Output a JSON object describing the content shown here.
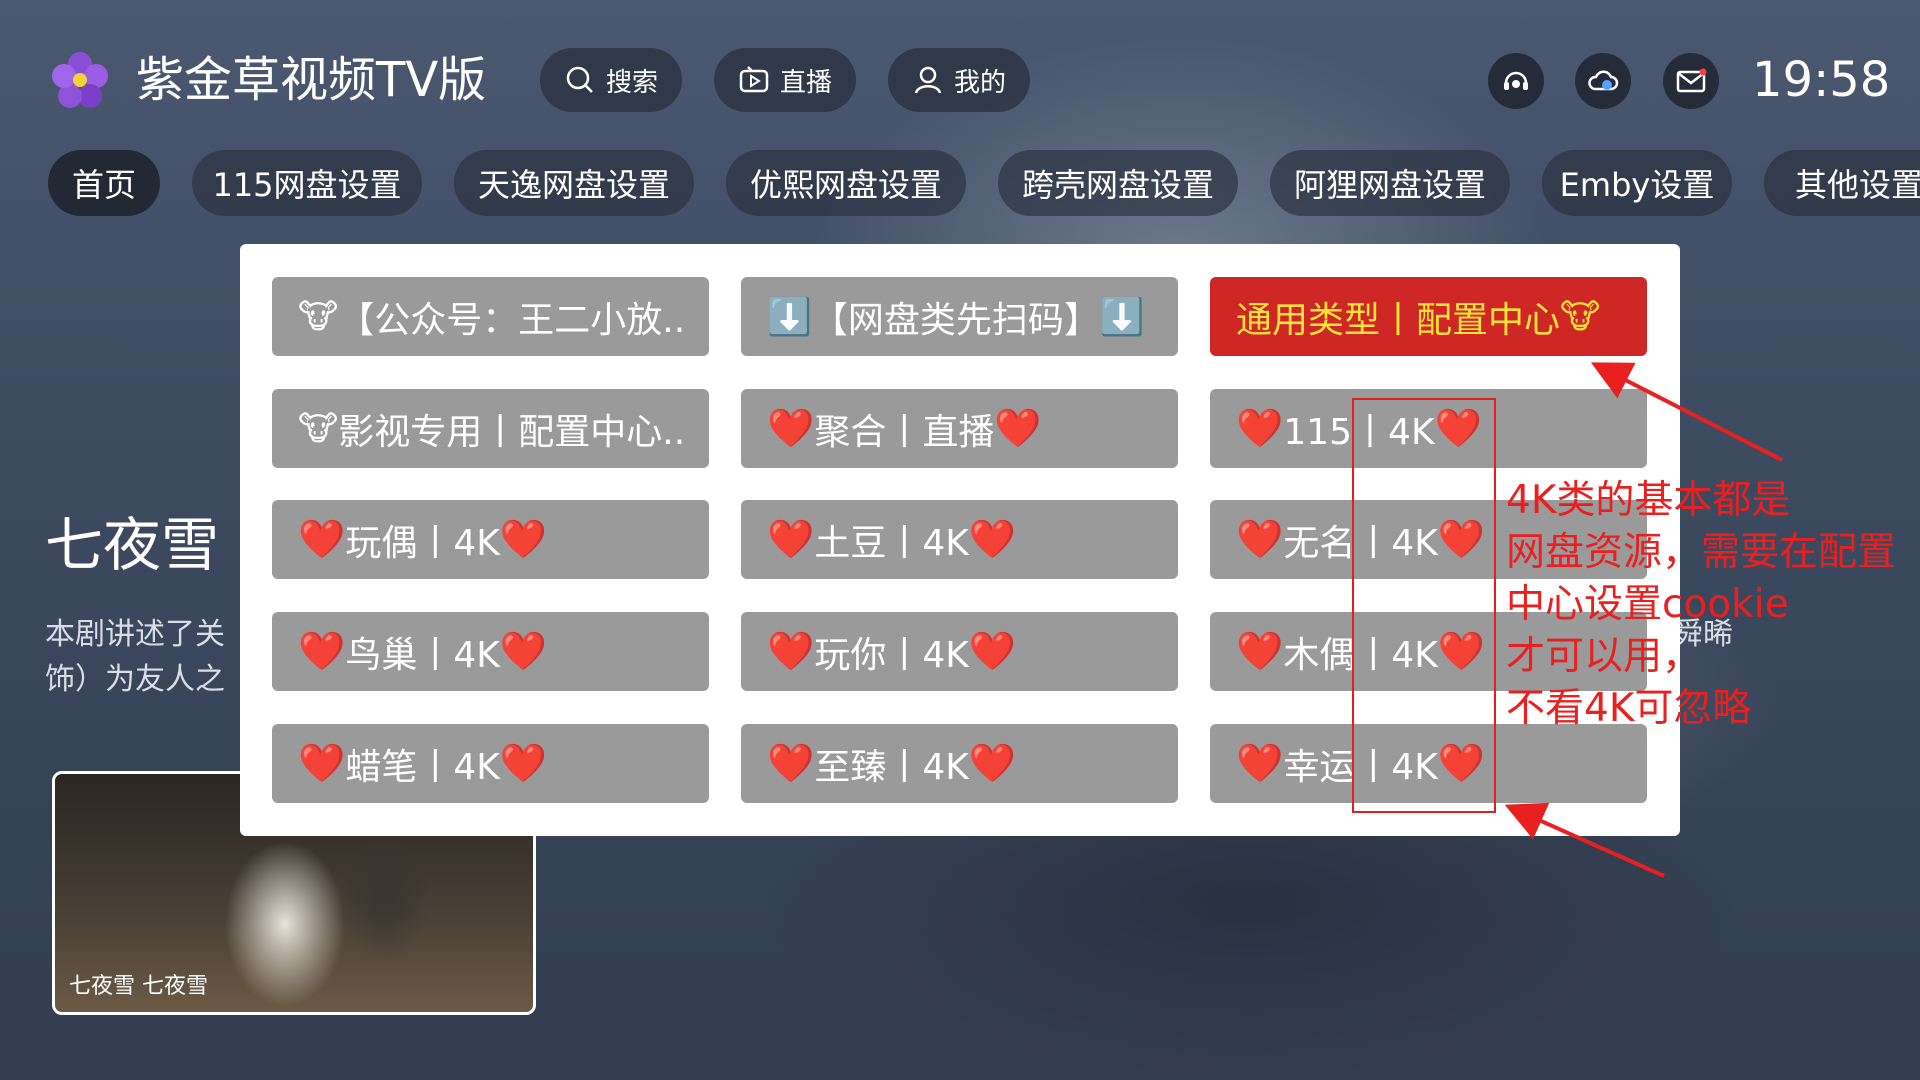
{
  "app": {
    "title": "紫金草视频TV版",
    "clock": "19:58"
  },
  "nav": {
    "search": "搜索",
    "live": "直播",
    "mine": "我的"
  },
  "header_icons": [
    "support-icon",
    "cloud-icon",
    "mail-icon"
  ],
  "tabs": [
    {
      "label": "首页",
      "active": true
    },
    {
      "label": "115网盘设置"
    },
    {
      "label": "天逸网盘设置"
    },
    {
      "label": "优熙网盘设置"
    },
    {
      "label": "跨壳网盘设置"
    },
    {
      "label": "阿狸网盘设置"
    },
    {
      "label": "Emby设置"
    },
    {
      "label": "其他设置"
    }
  ],
  "hero": {
    "title": "七夜雪",
    "desc_left": "本剧讲述了关",
    "desc_left_2": "饰）为友人之",
    "desc_right": "由（曾舜晞"
  },
  "thumbnail": {
    "caption": "七夜雪    七夜雪"
  },
  "popup": {
    "items": [
      {
        "text": "【公众号：王二小放..",
        "prefix": "🐮",
        "suffix": ""
      },
      {
        "text": "【网盘类先扫码】",
        "prefix": "⬇️",
        "suffix": "⬇️"
      },
      {
        "text": "通用类型丨配置中心",
        "prefix": "",
        "suffix": "🐮",
        "highlight": true
      },
      {
        "text": "影视专用丨配置中心..",
        "prefix": "🐮",
        "suffix": ""
      },
      {
        "text": "聚合丨直播",
        "prefix": "❤️",
        "suffix": "❤️"
      },
      {
        "text": "115丨4K",
        "prefix": "❤️",
        "suffix": "❤️"
      },
      {
        "text": "玩偶丨4K",
        "prefix": "❤️",
        "suffix": "❤️"
      },
      {
        "text": "土豆丨4K",
        "prefix": "❤️",
        "suffix": "❤️"
      },
      {
        "text": "无名丨4K",
        "prefix": "❤️",
        "suffix": "❤️"
      },
      {
        "text": "鸟巢丨4K",
        "prefix": "❤️",
        "suffix": "❤️"
      },
      {
        "text": "玩你丨4K",
        "prefix": "❤️",
        "suffix": "❤️"
      },
      {
        "text": "木偶丨4K",
        "prefix": "❤️",
        "suffix": "❤️"
      },
      {
        "text": "蜡笔丨4K",
        "prefix": "❤️",
        "suffix": "❤️"
      },
      {
        "text": "至臻丨4K",
        "prefix": "❤️",
        "suffix": "❤️"
      },
      {
        "text": "幸运丨4K",
        "prefix": "❤️",
        "suffix": "❤️"
      }
    ]
  },
  "annotation": {
    "lines": [
      "4K类的基本都是",
      "网盘资源，需要在配置",
      "中心设置cookie",
      "才可以用，",
      "不看4K可忽略"
    ],
    "color": "#e82020"
  }
}
